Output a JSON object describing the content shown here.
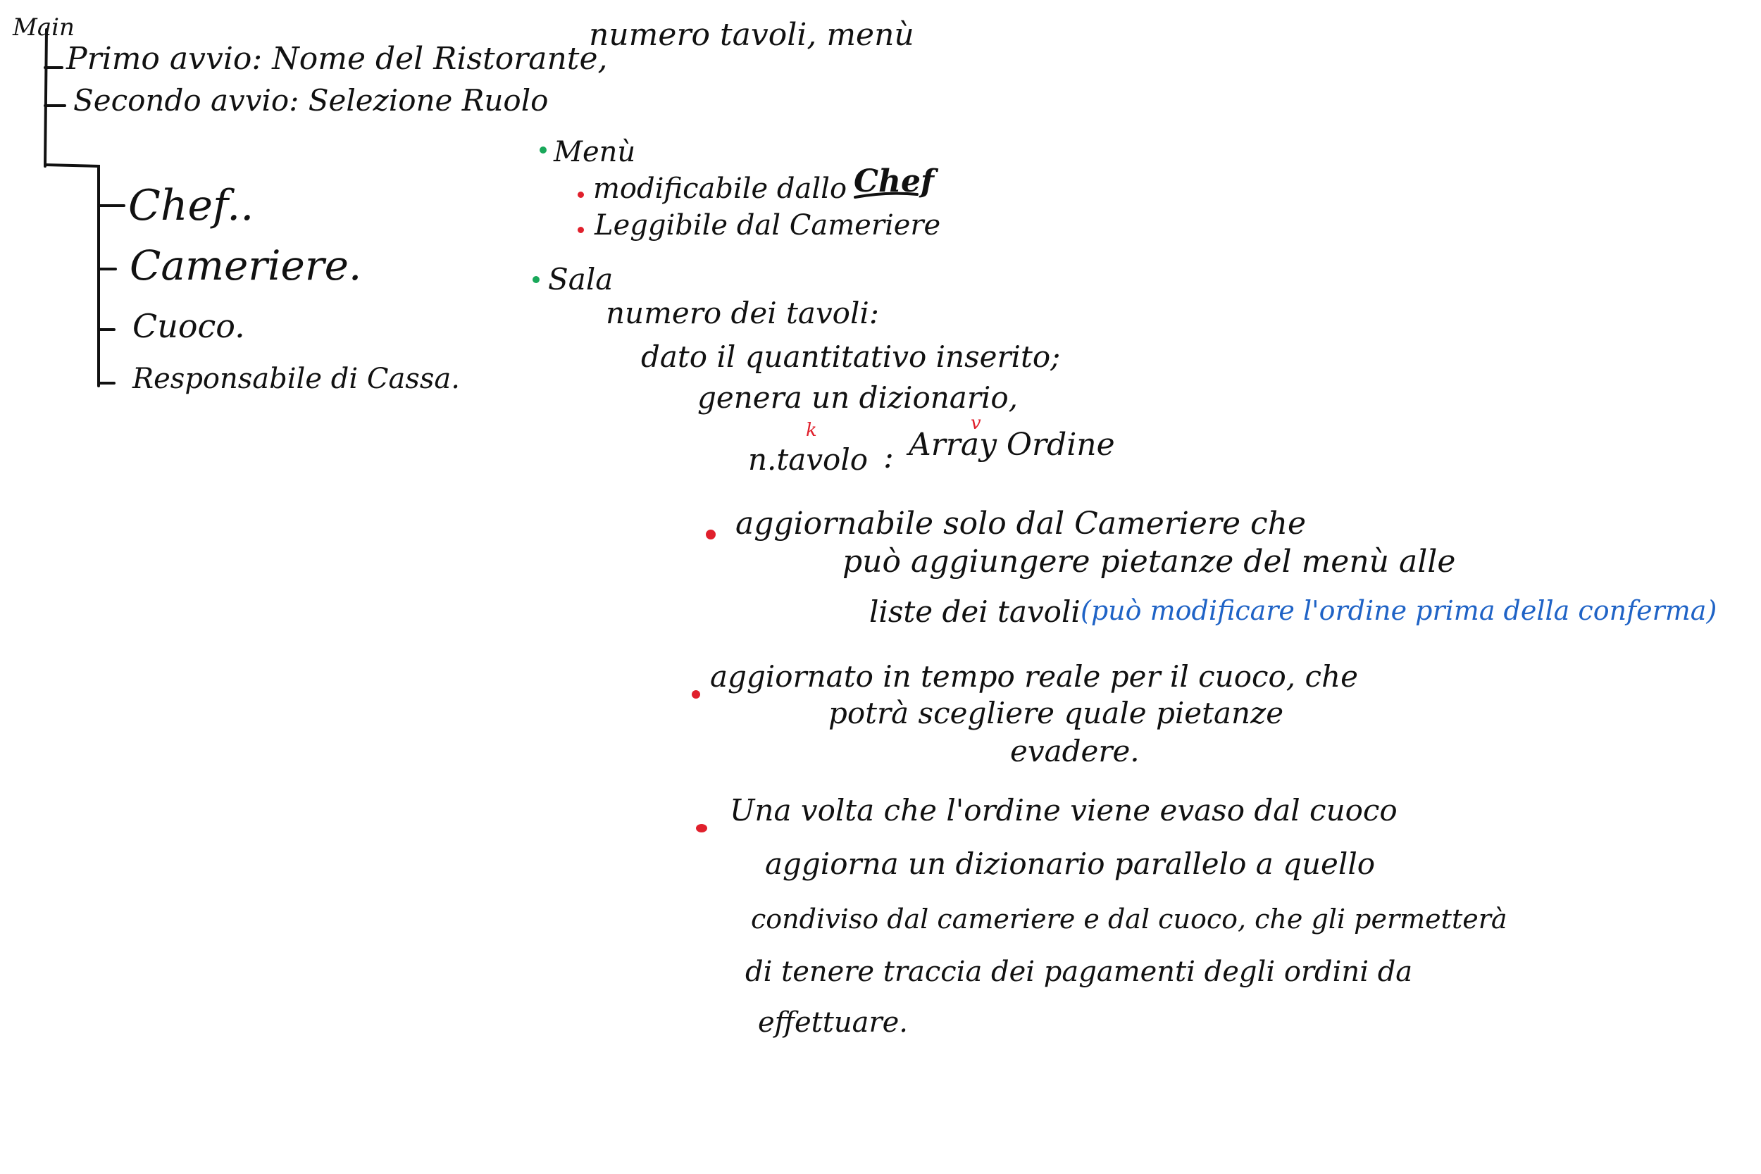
{
  "colors": {
    "ink": "#111111",
    "green_bullet": "#19a85a",
    "red_bullet": "#e0202c",
    "blue_note": "#1f63c6",
    "red_annotation": "#e0202c"
  },
  "tree": {
    "root": "Main",
    "first_start": "Primo avvio: Nome del Ristorante,",
    "first_start_cont": "numero tavoli, menù",
    "second_start": "Secondo avvio: Selezione Ruolo",
    "roles": [
      "Chef..",
      "Cameriere.",
      "Cuoco.",
      "Responsabile di Cassa."
    ]
  },
  "menu_section": {
    "title": "Menù",
    "items": [
      {
        "text": "modificabile dallo",
        "emphasis": "Chef"
      },
      {
        "text": "Leggibile dal Cameriere"
      }
    ]
  },
  "sala_section": {
    "title": "Sala",
    "line1": "numero dei tavoli:",
    "line2": "dato il quantitativo inserito;",
    "line3": "genera un dizionario,",
    "key_label": "n.tavolo",
    "separator": ":",
    "value_label": "Array Ordine",
    "key_mark": "k",
    "value_mark": "v"
  },
  "notes": [
    {
      "lines": [
        "aggiornabile solo dal Cameriere che",
        "può aggiungere pietanze del menù alle",
        "liste dei tavoli"
      ],
      "blue_note": "(può modificare l'ordine prima della conferma)"
    },
    {
      "lines": [
        "aggiornato in tempo reale per il cuoco, che",
        "potrà scegliere quale pietanze",
        "evadere."
      ]
    },
    {
      "lines": [
        "Una volta che l'ordine viene evaso dal cuoco",
        "aggiorna un dizionario parallelo a quello",
        "condiviso dal cameriere e dal cuoco, che gli permetterà",
        "di tenere traccia dei pagamenti degli ordini da",
        "effettuare."
      ]
    }
  ]
}
